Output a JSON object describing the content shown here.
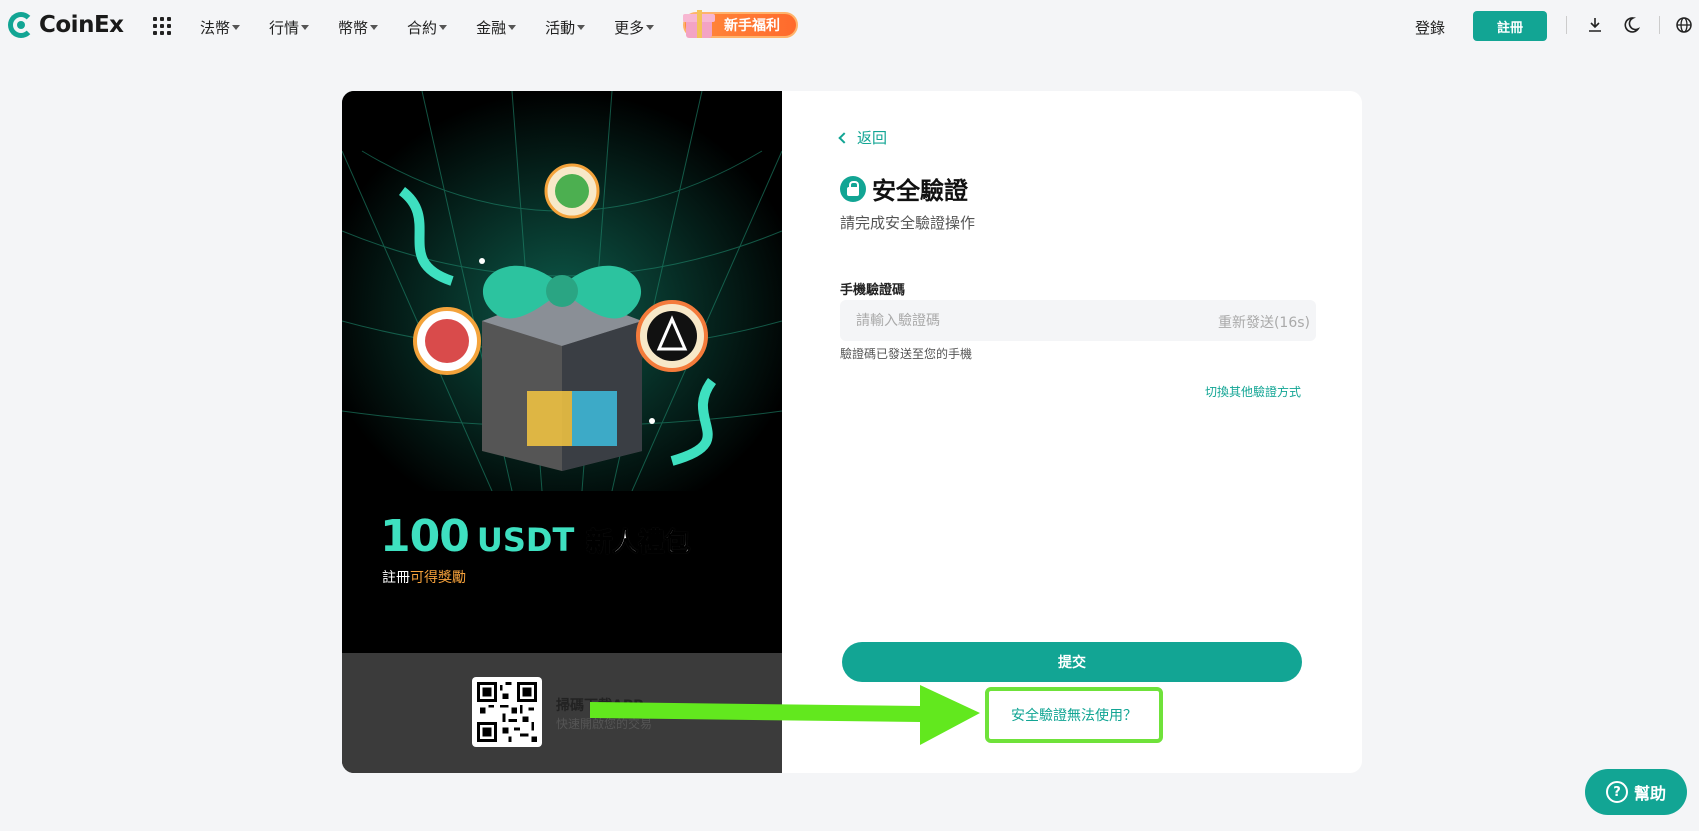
{
  "header": {
    "logo_text": "CoinEx",
    "nav": [
      "法幣",
      "行情",
      "幣幣",
      "合約",
      "金融",
      "活動",
      "更多"
    ],
    "promo_label": "新手福利",
    "login_label": "登錄",
    "register_label": "註冊",
    "icons": [
      "apps-grid-icon",
      "download-icon",
      "moon-icon",
      "globe-icon"
    ]
  },
  "left": {
    "amount": "100",
    "unit": "USDT",
    "gift_text": "新人禮包",
    "sub_prefix": "註冊",
    "sub_highlight": "可得獎勵",
    "download_title": "掃碼下載APP",
    "download_sub": "快速開啟您的交易"
  },
  "right": {
    "back_label": "返回",
    "title": "安全驗證",
    "subtitle": "請完成安全驗證操作",
    "field_label": "手機驗證碼",
    "field_placeholder": "請輸入驗證碼",
    "resend": "重新發送(16s)",
    "hint": "驗證碼已發送至您的手機",
    "switch_label": "切換其他驗證方式",
    "submit_label": "提交",
    "unusable_label": "安全驗證無法使用？"
  },
  "help": {
    "label": "幫助"
  },
  "colors": {
    "accent": "#12a594",
    "promo": "#ff7a33",
    "annotation": "#6fe23a"
  }
}
